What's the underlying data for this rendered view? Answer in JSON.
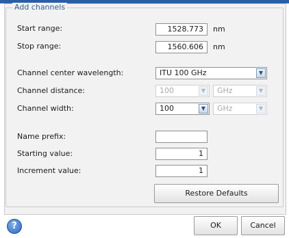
{
  "group": {
    "title": "Add channels"
  },
  "start_range": {
    "label": "Start range:",
    "value": "1528.773",
    "unit": "nm"
  },
  "stop_range": {
    "label": "Stop range:",
    "value": "1560.606",
    "unit": "nm"
  },
  "channel_center": {
    "label": "Channel center wavelength:",
    "selected": "ITU 100 GHz"
  },
  "channel_distance": {
    "label": "Channel distance:",
    "value": "100",
    "unit": "GHz"
  },
  "channel_width": {
    "label": "Channel width:",
    "value": "100",
    "unit": "GHz"
  },
  "name_prefix": {
    "label": "Name prefix:",
    "value": ""
  },
  "starting_value": {
    "label": "Starting value:",
    "value": "1"
  },
  "increment_value": {
    "label": "Increment value:",
    "value": "1"
  },
  "restore_defaults_label": "Restore Defaults",
  "footer": {
    "help_glyph": "?",
    "ok_label": "OK",
    "cancel_label": "Cancel"
  },
  "icons": {
    "dropdown": "chevron-down-icon",
    "help": "help-icon"
  },
  "colors": {
    "accent": "#2a5fa8",
    "legend_text": "#3a5a8c",
    "disabled_text": "#a8a8a8"
  }
}
